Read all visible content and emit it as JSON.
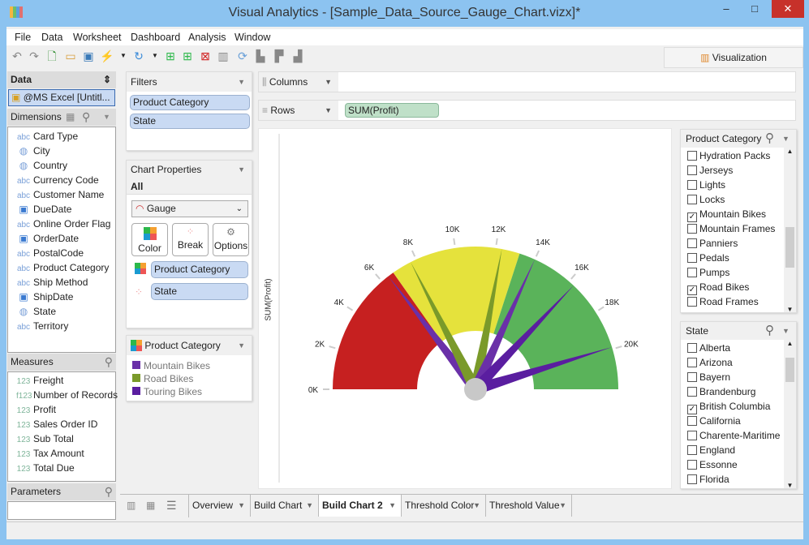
{
  "window": {
    "title": "Visual Analytics - [Sample_Data_Source_Gauge_Chart.vizx]*",
    "minimize": "–",
    "maximize": "□",
    "close": "✕"
  },
  "menu": [
    "File",
    "Data",
    "Worksheet",
    "Dashboard",
    "Analysis",
    "Window"
  ],
  "toolbar": {
    "visualization_tab": "Visualization"
  },
  "data_panel": {
    "header": "Data",
    "source": "@MS Excel [Untitl...",
    "dimensions_label": "Dimensions",
    "dimensions": [
      {
        "icon": "abc",
        "label": "Card Type"
      },
      {
        "icon": "globe",
        "label": "City"
      },
      {
        "icon": "globe",
        "label": "Country"
      },
      {
        "icon": "abc",
        "label": "Currency Code"
      },
      {
        "icon": "abc",
        "label": "Customer Name"
      },
      {
        "icon": "date",
        "label": "DueDate"
      },
      {
        "icon": "abc",
        "label": "Online Order Flag"
      },
      {
        "icon": "date",
        "label": "OrderDate"
      },
      {
        "icon": "abc",
        "label": "PostalCode"
      },
      {
        "icon": "abc",
        "label": "Product Category"
      },
      {
        "icon": "abc",
        "label": "Ship Method"
      },
      {
        "icon": "date",
        "label": "ShipDate"
      },
      {
        "icon": "globe",
        "label": "State"
      },
      {
        "icon": "abc",
        "label": "Territory"
      }
    ],
    "measures_label": "Measures",
    "measures": [
      {
        "icon": "123",
        "label": "Freight"
      },
      {
        "icon": "f123",
        "label": "Number of Records"
      },
      {
        "icon": "123",
        "label": "Profit"
      },
      {
        "icon": "123",
        "label": "Sales Order ID"
      },
      {
        "icon": "123",
        "label": "Sub Total"
      },
      {
        "icon": "123",
        "label": "Tax Amount"
      },
      {
        "icon": "123",
        "label": "Total Due"
      }
    ],
    "parameters_label": "Parameters"
  },
  "filters": {
    "header": "Filters",
    "items": [
      "Product Category",
      "State"
    ]
  },
  "chart_properties": {
    "header": "Chart Properties",
    "all": "All",
    "chart_type": "Gauge",
    "buttons": [
      "Color",
      "Break",
      "Options"
    ],
    "color_field": "Product Category",
    "break_field": "State"
  },
  "legend": {
    "header": "Product Category",
    "items": [
      {
        "label": "Mountain Bikes",
        "color": "#6a30a8"
      },
      {
        "label": "Road Bikes",
        "color": "#7a9a2a"
      },
      {
        "label": "Touring Bikes",
        "color": "#5a1ea0"
      }
    ]
  },
  "shelves": {
    "columns_label": "Columns",
    "rows_label": "Rows",
    "rows_pill": "SUM(Profit)"
  },
  "chart_data": {
    "type": "gauge",
    "ylabel": "SUM(Profit)",
    "range": [
      0,
      22000
    ],
    "ticks": [
      {
        "v": 0,
        "label": "0K"
      },
      {
        "v": 2000,
        "label": "2K"
      },
      {
        "v": 4000,
        "label": "4K"
      },
      {
        "v": 6000,
        "label": "6K"
      },
      {
        "v": 8000,
        "label": "8K"
      },
      {
        "v": 10000,
        "label": "10K"
      },
      {
        "v": 12000,
        "label": "12K"
      },
      {
        "v": 14000,
        "label": "14K"
      },
      {
        "v": 16000,
        "label": "16K"
      },
      {
        "v": 18000,
        "label": "18K"
      },
      {
        "v": 20000,
        "label": "20K"
      }
    ],
    "bands": [
      {
        "from": 0,
        "to": 6700,
        "color": "#c62020"
      },
      {
        "from": 6700,
        "to": 13200,
        "color": "#e5e23c"
      },
      {
        "from": 13200,
        "to": 22000,
        "color": "#5ab35a"
      }
    ],
    "needles": [
      {
        "series": "Mountain Bikes",
        "value": 6400,
        "color": "#6a30a8"
      },
      {
        "series": "Road Bikes",
        "value": 7700,
        "color": "#7a9a2a"
      },
      {
        "series": "Road Bikes",
        "value": 12300,
        "color": "#7a9a2a"
      },
      {
        "series": "Mountain Bikes",
        "value": 14000,
        "color": "#6a30a8"
      },
      {
        "series": "Touring Bikes",
        "value": 16300,
        "color": "#5a1ea0"
      },
      {
        "series": "Touring Bikes",
        "value": 19900,
        "color": "#5a1ea0"
      }
    ]
  },
  "product_filter": {
    "header": "Product Category",
    "items": [
      {
        "label": "Hydration Packs",
        "checked": false
      },
      {
        "label": "Jerseys",
        "checked": false
      },
      {
        "label": "Lights",
        "checked": false
      },
      {
        "label": "Locks",
        "checked": false
      },
      {
        "label": "Mountain Bikes",
        "checked": true
      },
      {
        "label": "Mountain Frames",
        "checked": false
      },
      {
        "label": "Panniers",
        "checked": false
      },
      {
        "label": "Pedals",
        "checked": false
      },
      {
        "label": "Pumps",
        "checked": false
      },
      {
        "label": "Road Bikes",
        "checked": true
      },
      {
        "label": "Road Frames",
        "checked": false
      }
    ]
  },
  "state_filter": {
    "header": "State",
    "items": [
      {
        "label": "Alberta",
        "checked": false
      },
      {
        "label": "Arizona",
        "checked": false
      },
      {
        "label": "Bayern",
        "checked": false
      },
      {
        "label": "Brandenburg",
        "checked": false
      },
      {
        "label": "British Columbia",
        "checked": true
      },
      {
        "label": "California",
        "checked": false
      },
      {
        "label": "Charente-Maritime",
        "checked": false
      },
      {
        "label": "England",
        "checked": false
      },
      {
        "label": "Essonne",
        "checked": false
      },
      {
        "label": "Florida",
        "checked": false
      }
    ]
  },
  "sheet_tabs": [
    {
      "label": "Overview",
      "active": false
    },
    {
      "label": "Build Chart",
      "active": false
    },
    {
      "label": "Build Chart 2",
      "active": true
    },
    {
      "label": "Threshold Color",
      "active": false
    },
    {
      "label": "Threshold Value",
      "active": false
    }
  ]
}
